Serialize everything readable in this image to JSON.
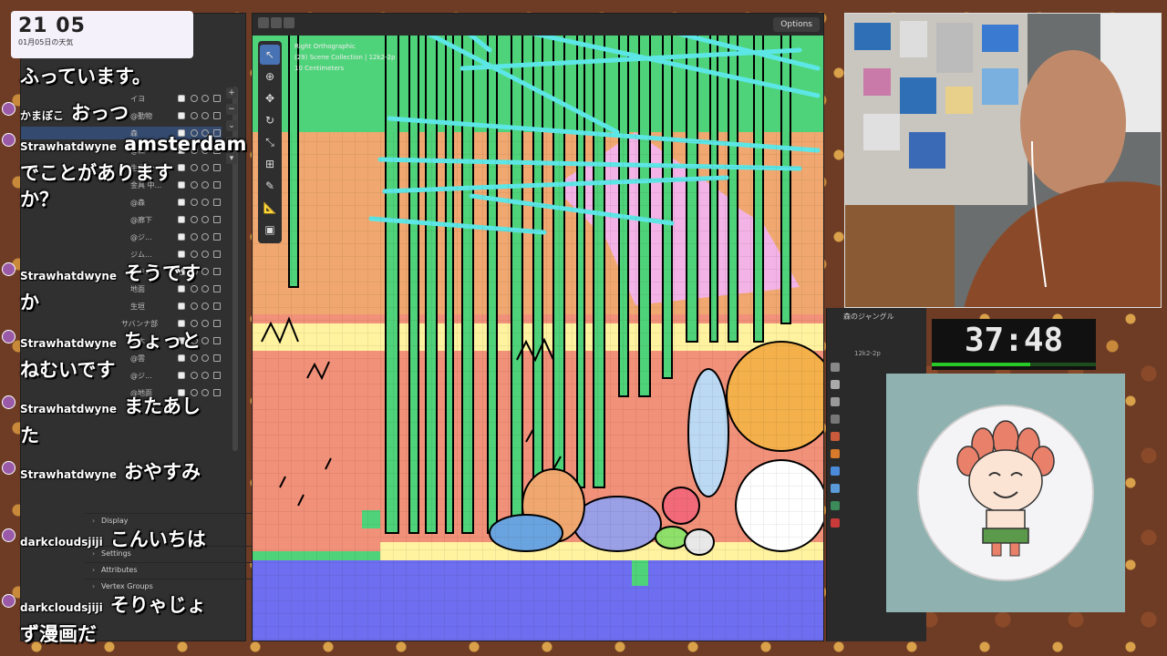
{
  "clock": {
    "time": "21 05",
    "weather": "01月05日の天気"
  },
  "viewport": {
    "options_label": "Options",
    "info_lines": [
      "Right Orthographic",
      "(29) Scene Collection | 12k2-2p",
      "10 Centimeters"
    ]
  },
  "outliner": {
    "items": [
      {
        "label": "イヨ",
        "selected": false
      },
      {
        "label": "@動物",
        "selected": false
      },
      {
        "label": "森",
        "selected": true
      },
      {
        "label": "@森",
        "selected": false
      },
      {
        "label": "生垣〜〜",
        "selected": false
      },
      {
        "label": "金具 中...",
        "selected": false
      },
      {
        "label": "@森",
        "selected": false
      },
      {
        "label": "@廊下",
        "selected": false
      },
      {
        "label": "@ジ...",
        "selected": false
      },
      {
        "label": "ジム...",
        "selected": false
      },
      {
        "label": "@ジ...",
        "selected": false
      },
      {
        "label": "地面",
        "selected": false
      },
      {
        "label": "生垣",
        "selected": false
      },
      {
        "label": "サバンナ部",
        "selected": false
      },
      {
        "label": "@木",
        "selected": false
      },
      {
        "label": "@雲",
        "selected": false
      },
      {
        "label": "@ジ...",
        "selected": false
      },
      {
        "label": "@地面",
        "selected": false
      }
    ]
  },
  "properties": {
    "sections": [
      "Display",
      "Settings",
      "Attributes",
      "Vertex Groups"
    ]
  },
  "chat": {
    "messages": [
      {
        "name": "",
        "text": "ふっています。"
      },
      {
        "name": "かまぼこ",
        "text": "おっつ"
      },
      {
        "name": "Strawhatdwyne",
        "text": "amsterdamでことがありますか？"
      },
      {
        "name": "Strawhatdwyne",
        "text": "そうですか"
      },
      {
        "name": "Strawhatdwyne",
        "text": "ちょっとねむいです"
      },
      {
        "name": "Strawhatdwyne",
        "text": "またあした"
      },
      {
        "name": "Strawhatdwyne",
        "text": "おやすみ"
      },
      {
        "name": "darkcloudsjiji",
        "text": "こんいちは"
      },
      {
        "name": "darkcloudsjiji",
        "text": "そりゃじょず漫画だ"
      }
    ]
  },
  "right_panel": {
    "collection_label": "森のジャングル",
    "object_label": "12k2-2p"
  },
  "timer": {
    "value": "37:48",
    "progress": 0.6
  },
  "colors": {
    "grass_green": "#4fd37a",
    "cyan_stroke": "#5ce6e6",
    "sand": "#f0a870",
    "pink": "#f2917a",
    "sky_pink": "#f3b3e6",
    "ground_blue": "#6e6ef0",
    "yellow": "#fff3a0"
  }
}
